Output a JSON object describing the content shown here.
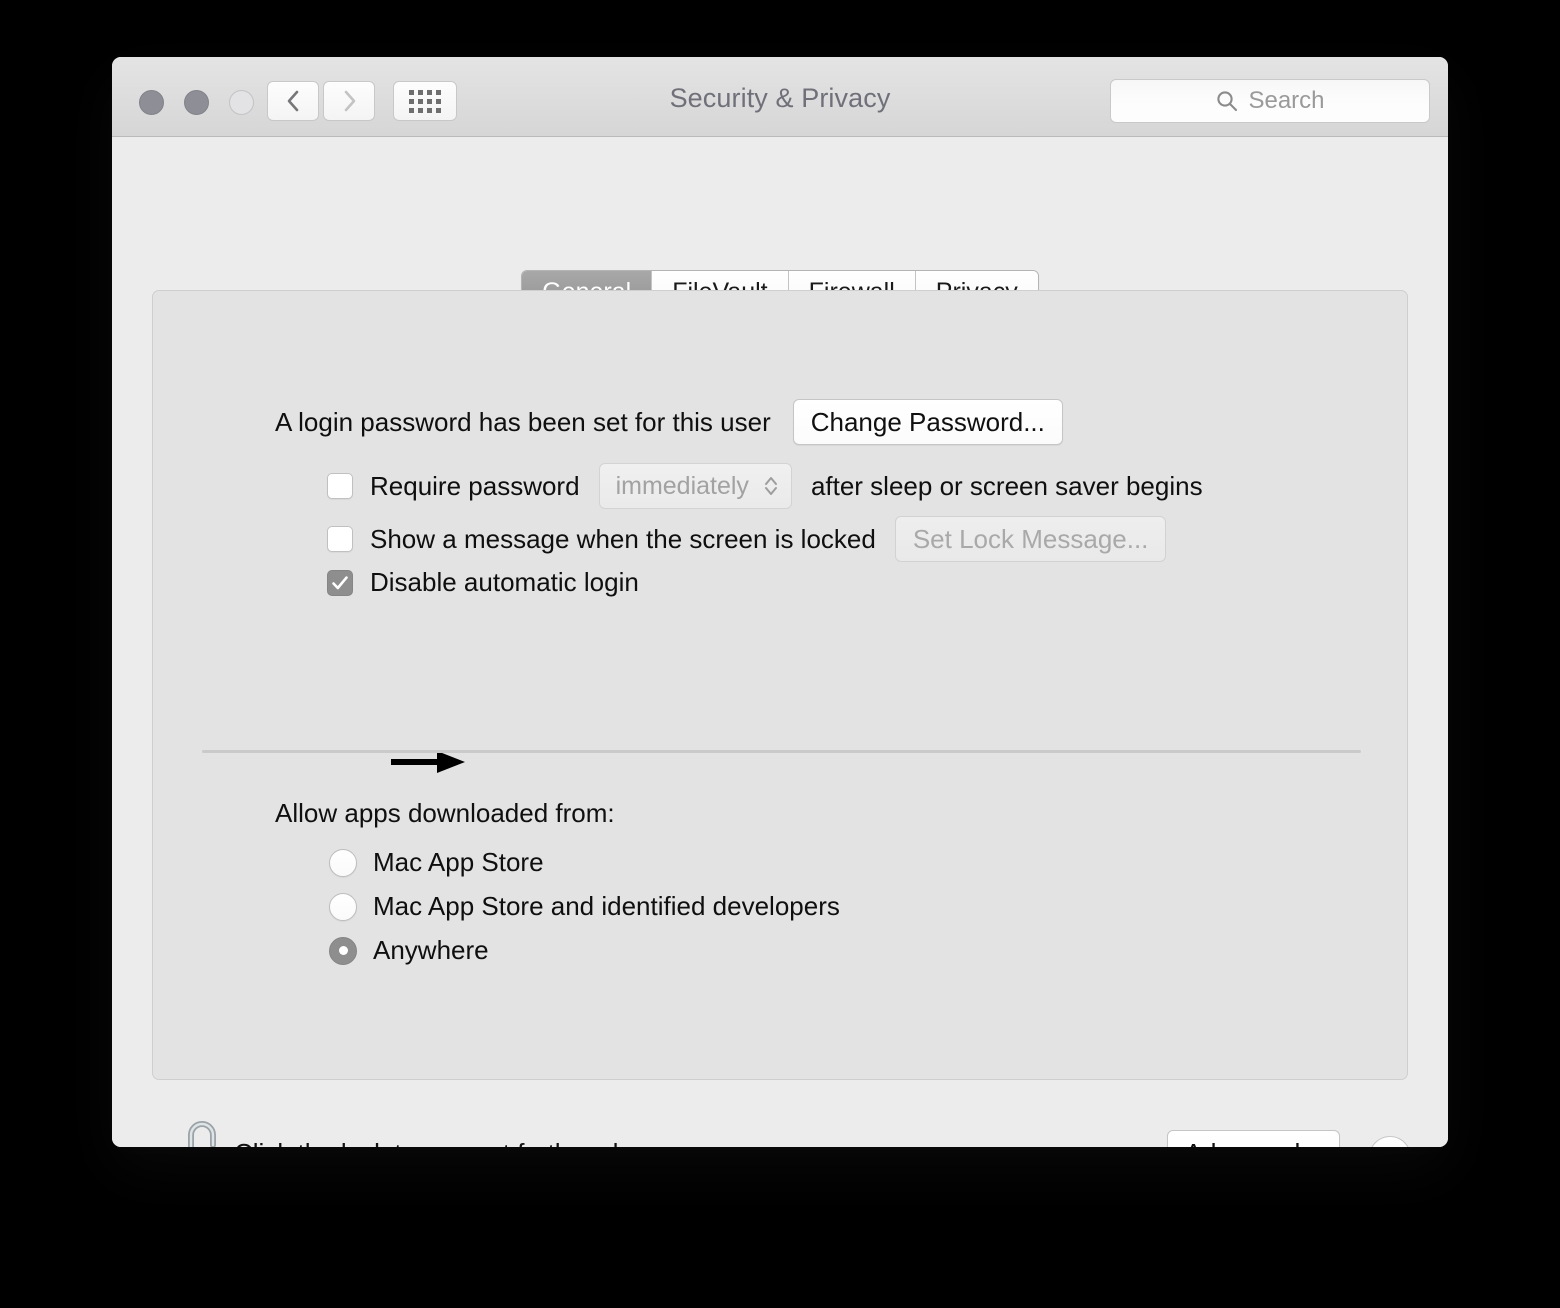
{
  "window": {
    "title": "Security & Privacy",
    "traffic_lights": [
      "close-button",
      "minimize-button",
      "zoom-button"
    ],
    "nav": {
      "back": "back-button",
      "forward": "forward-button",
      "show_all": "show-all-button"
    },
    "search": {
      "placeholder": "Search",
      "value": ""
    }
  },
  "tabs": [
    {
      "label": "General",
      "selected": true
    },
    {
      "label": "FileVault",
      "selected": false
    },
    {
      "label": "Firewall",
      "selected": false
    },
    {
      "label": "Privacy",
      "selected": false
    }
  ],
  "general": {
    "password_status": "A login password has been set for this user",
    "change_password_button": "Change Password...",
    "require_password": {
      "label": "Require password",
      "checked": false,
      "interval_value": "immediately",
      "trailing_label": "after sleep or screen saver begins",
      "enabled": false
    },
    "lock_message": {
      "label": "Show a message when the screen is locked",
      "checked": false,
      "button": "Set Lock Message...",
      "button_enabled": false
    },
    "disable_automatic_login": {
      "label": "Disable automatic login",
      "checked": true,
      "annotated": true
    },
    "allow_apps": {
      "heading": "Allow apps downloaded from:",
      "options": [
        {
          "label": "Mac App Store",
          "selected": false
        },
        {
          "label": "Mac App Store and identified developers",
          "selected": false
        },
        {
          "label": "Anywhere",
          "selected": true
        }
      ]
    }
  },
  "footer": {
    "lock_icon": "unlocked-padlock-icon",
    "lock_text": "Click the lock to prevent further changes.",
    "advanced_button": "Advanced...",
    "help_button": "?"
  },
  "colors": {
    "window_bg": "#ececec",
    "panel_bg": "#e3e3e3",
    "titlebar_top": "#e4e4e4",
    "titlebar_bottom": "#d6d6d6",
    "selected_tab": "#919191",
    "help_blue": "#1277e8",
    "control_gray": "#8e8e8e",
    "desktop_bg": "#000000"
  }
}
